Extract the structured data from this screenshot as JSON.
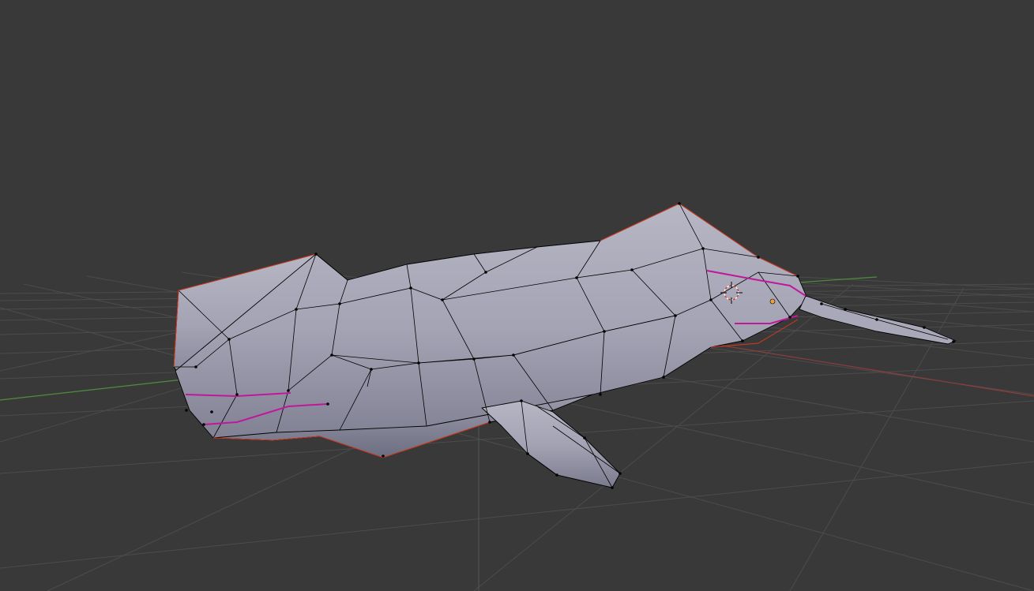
{
  "viewport": {
    "background": "#393939",
    "grid_color": "#4a4a4a",
    "x_axis_color": "#8f3d3d",
    "y_axis_color": "#4d8f3d",
    "mesh_object": "narwhal",
    "mode": "edit-mode-wireframe-overlay",
    "seam_color": "#c0189a",
    "boundary_color": "#d43a1e",
    "vertex_color": "#000000",
    "cursor_icon": "3d-cursor-icon",
    "origin_icon": "object-origin-icon"
  }
}
